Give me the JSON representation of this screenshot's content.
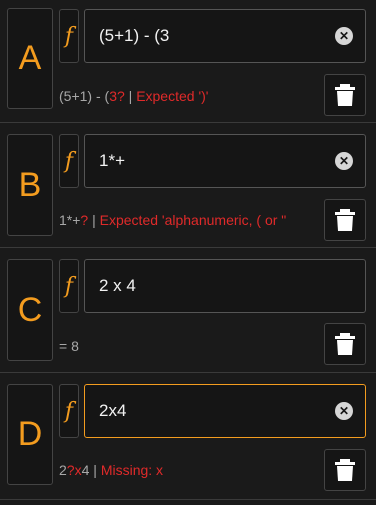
{
  "colors": {
    "accent": "#f39c1f",
    "error": "#e02a2a",
    "muted": "#a8a8a8",
    "background": "#1a1a1a"
  },
  "rows": [
    {
      "letter": "A",
      "f_symbol": "f",
      "expression": "(5+1) - (3",
      "status_prefix": "(5+1) - (",
      "status_error_mark": "3?",
      "status_sep": " | ",
      "status_error": "Expected ')'"
    },
    {
      "letter": "B",
      "f_symbol": "f",
      "expression": "1*+",
      "status_prefix": "1*+",
      "status_error_mark": "?",
      "status_sep": " | ",
      "status_error": "Expected 'alphanumeric, ( or \""
    },
    {
      "letter": "C",
      "f_symbol": "f",
      "expression": "2 x 4",
      "status_result": "= 8"
    },
    {
      "letter": "D",
      "f_symbol": "f",
      "expression": "2x4",
      "status_prefix": "2",
      "status_error_mark": "?x",
      "status_suffix": "4",
      "status_sep": " | ",
      "status_error": "Missing: x"
    }
  ],
  "icons": {
    "clear": "clear-circle-icon",
    "delete": "trash-icon",
    "function": "function-icon"
  }
}
